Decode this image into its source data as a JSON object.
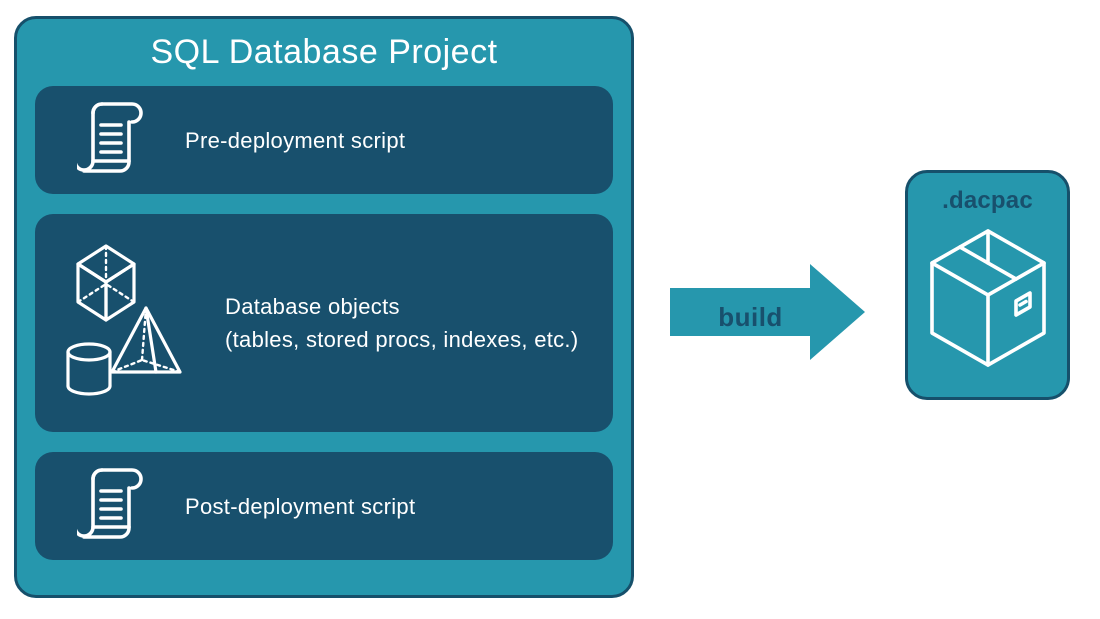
{
  "project": {
    "title": "SQL Database Project",
    "rows": [
      {
        "label": "Pre-deployment script"
      },
      {
        "label_line1": "Database objects",
        "label_line2": "(tables, stored procs, indexes, etc.)"
      },
      {
        "label": "Post-deployment script"
      }
    ]
  },
  "arrow": {
    "label": "build"
  },
  "output": {
    "title": ".dacpac"
  },
  "colors": {
    "panel_bg": "#2697ad",
    "panel_border": "#16506b",
    "row_bg": "#18506d",
    "text_on_dark": "#ffffff",
    "text_on_teal": "#18506d"
  }
}
